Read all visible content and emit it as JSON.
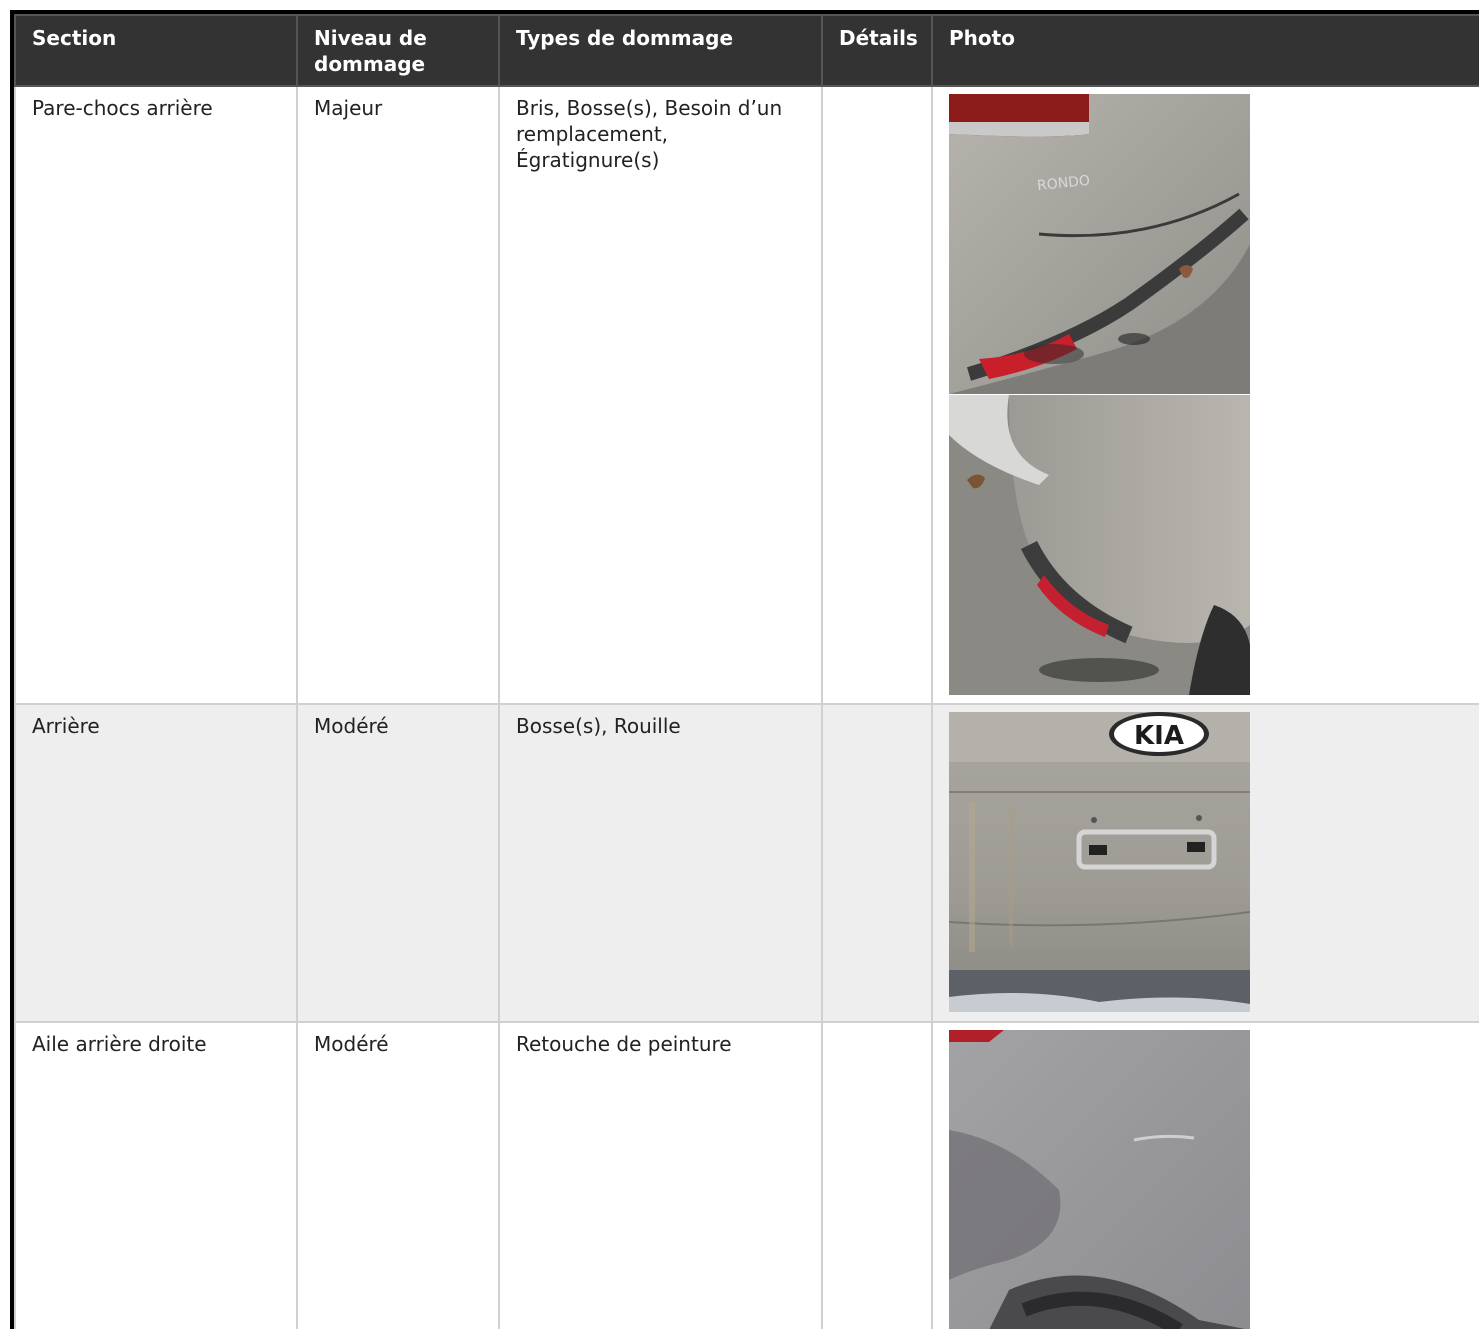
{
  "headers": {
    "section": "Section",
    "niveau": "Niveau de dommage",
    "types": "Types de dommage",
    "details": "Détails",
    "photo": "Photo"
  },
  "rows": [
    {
      "section": "Pare-chocs arrière",
      "niveau": "Majeur",
      "types": "Bris, Bosse(s), Besoin d’un remplacement, Égratignure(s)",
      "details": "",
      "photos": [
        "rear-bumper-damage-photo-1",
        "rear-bumper-damage-photo-2"
      ],
      "badge_text": "RONDO"
    },
    {
      "section": "Arrière",
      "niveau": "Modéré",
      "types": "Bosse(s), Rouille",
      "details": "",
      "photos": [
        "rear-trunk-kia-photo"
      ],
      "badge_text": "KIA"
    },
    {
      "section": "Aile arrière droite",
      "niveau": "Modéré",
      "types": "Retouche de peinture",
      "details": "",
      "photos": [
        "rear-right-fender-photo"
      ]
    }
  ]
}
